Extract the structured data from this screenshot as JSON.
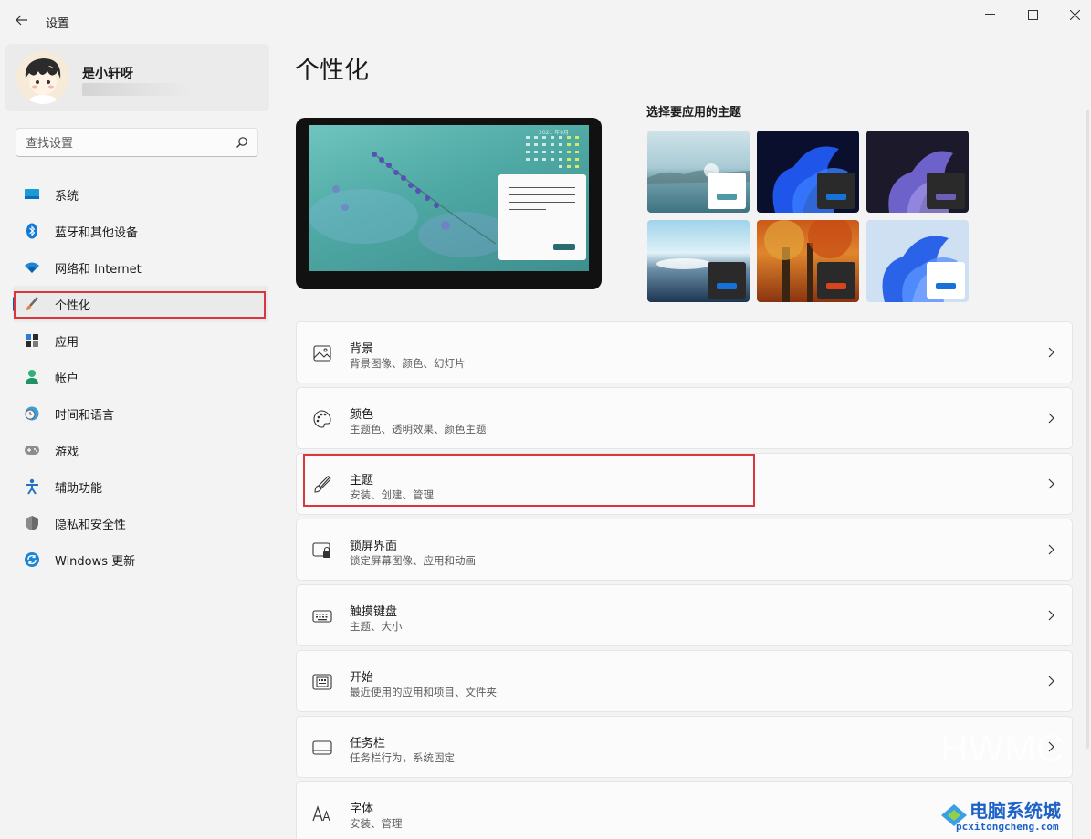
{
  "window": {
    "title": "设置",
    "controls": [
      "minimize-icon",
      "maximize-icon",
      "close-icon"
    ]
  },
  "user": {
    "name": "是小轩呀"
  },
  "search": {
    "placeholder": "查找设置"
  },
  "sidebar": {
    "items": [
      {
        "label": "系统",
        "icon": "system-icon"
      },
      {
        "label": "蓝牙和其他设备",
        "icon": "bluetooth-icon"
      },
      {
        "label": "网络和 Internet",
        "icon": "wifi-icon"
      },
      {
        "label": "个性化",
        "icon": "brush-icon",
        "active": true
      },
      {
        "label": "应用",
        "icon": "apps-icon"
      },
      {
        "label": "帐户",
        "icon": "account-icon"
      },
      {
        "label": "时间和语言",
        "icon": "clock-globe-icon"
      },
      {
        "label": "游戏",
        "icon": "gamepad-icon"
      },
      {
        "label": "辅助功能",
        "icon": "accessibility-icon"
      },
      {
        "label": "隐私和安全性",
        "icon": "shield-icon"
      },
      {
        "label": "Windows 更新",
        "icon": "update-icon"
      }
    ]
  },
  "main": {
    "title": "个性化",
    "preview": {
      "calendar_header": "2021 年9月"
    },
    "themes_label": "选择要应用的主题",
    "themes": [
      {
        "name": "lake-theme",
        "chip_bg": "#ffffff",
        "accent": "#4a9aa9"
      },
      {
        "name": "bloom-dark-theme",
        "chip_bg": "#2a2a2a",
        "accent": "#1672d8"
      },
      {
        "name": "purple-bloom-theme",
        "chip_bg": "#2a2a2a",
        "accent": "#6b5fb8"
      },
      {
        "name": "sky-theme",
        "chip_bg": "#2a2a2a",
        "accent": "#1672d8"
      },
      {
        "name": "autumn-theme",
        "chip_bg": "#2a2a2a",
        "accent": "#d9441a"
      },
      {
        "name": "bloom-light-theme",
        "chip_bg": "#ffffff",
        "accent": "#1672d8"
      }
    ],
    "cards": [
      {
        "title": "背景",
        "sub": "背景图像、颜色、幻灯片",
        "icon": "image-icon"
      },
      {
        "title": "颜色",
        "sub": "主题色、透明效果、颜色主题",
        "icon": "palette-icon"
      },
      {
        "title": "主题",
        "sub": "安装、创建、管理",
        "icon": "brush-icon"
      },
      {
        "title": "锁屏界面",
        "sub": "锁定屏幕图像、应用和动画",
        "icon": "lock-screen-icon"
      },
      {
        "title": "触摸键盘",
        "sub": "主题、大小",
        "icon": "keyboard-icon"
      },
      {
        "title": "开始",
        "sub": "最近使用的应用和项目、文件夹",
        "icon": "start-icon"
      },
      {
        "title": "任务栏",
        "sub": "任务栏行为，系统固定",
        "icon": "taskbar-icon"
      },
      {
        "title": "字体",
        "sub": "安装、管理",
        "icon": "font-icon"
      }
    ]
  },
  "watermark": {
    "brand": "电脑系统城",
    "url": "pcxitongcheng.com",
    "faint": "HWMC"
  },
  "colors": {
    "accent": "#005fb8",
    "highlight_red": "#d9363e"
  }
}
